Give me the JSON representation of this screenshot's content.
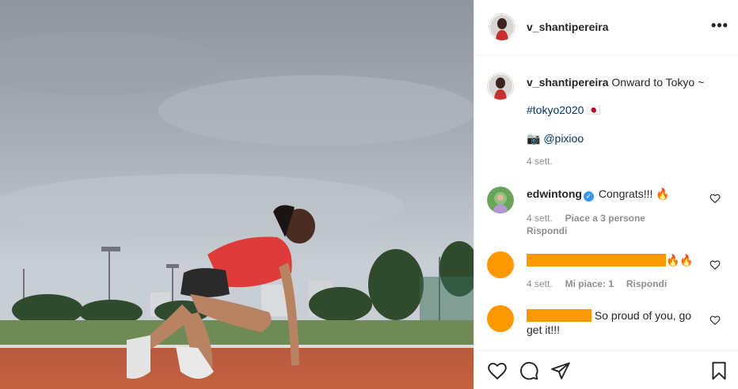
{
  "post": {
    "username": "v_shantipereira",
    "more_label": "•••"
  },
  "caption": {
    "username": "v_shantipereira",
    "text": "Onward to Tokyo ~",
    "hashtag": "#tokyo2020",
    "flag": "🇯🇵",
    "camera": "📷",
    "mention": "@pixioo",
    "time": "4 sett."
  },
  "comments": [
    {
      "username": "edwintong",
      "text": "Congrats!!! 🔥",
      "time": "4 sett.",
      "likes": "Piace a 3 persone",
      "reply": "Rispondi"
    },
    {
      "emoji": "🔥🔥",
      "time": "4 sett.",
      "likes": "Mi piace: 1",
      "reply": "Rispondi"
    },
    {
      "text": "So proud of you, go get it!!!"
    }
  ],
  "icons": {
    "like": "heart-icon",
    "comment": "comment-icon",
    "share": "share-icon",
    "save": "bookmark-icon"
  },
  "colors": {
    "link": "#00376b",
    "muted": "#8e8e8e",
    "redaction": "#ff9800",
    "verified": "#3897f0"
  }
}
